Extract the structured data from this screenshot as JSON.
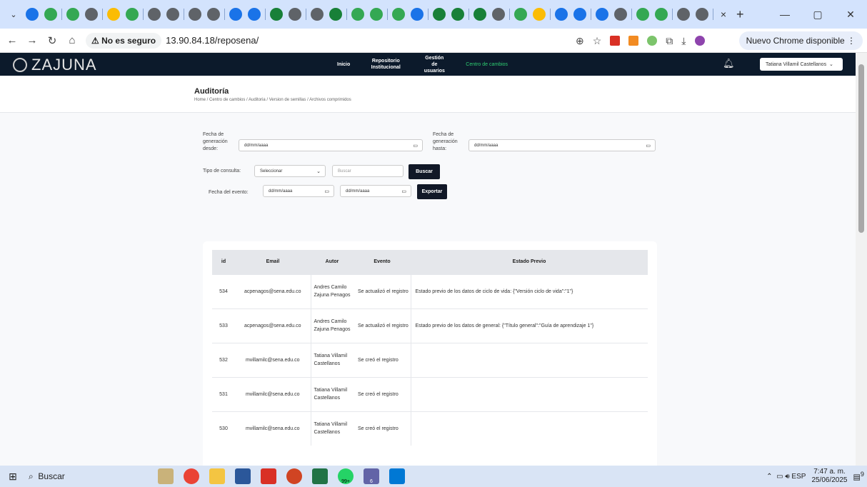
{
  "browser": {
    "tab_close": "×",
    "new_tab": "+",
    "insecure_label": "No es seguro",
    "url": "13.90.84.18/reposena/",
    "update_label": "Nuevo Chrome disponible"
  },
  "site": {
    "brand": "ZAJUNA",
    "menu": [
      "Inicio",
      "Repositorio Institucional",
      "Gestión de usuarios",
      "Centro de cambios"
    ],
    "user": "Tatiana Villamil Castellanos"
  },
  "header": {
    "title": "Auditoría",
    "breadcrumb": "Home / Centro de cambios / Auditoria / Version de semillas / Archivos comprimidos"
  },
  "filters": {
    "fecha_desde_label": "Fecha de generación desde:",
    "fecha_hasta_label": "Fecha de generación hasta:",
    "date_placeholder": "dd/mm/aaaa",
    "tipo_label": "Tipo de consulta:",
    "tipo_value": "Seleccionar",
    "search_placeholder": "Buscar",
    "buscar_button": "Buscar",
    "evento_label": "Fecha del evento:",
    "exportar_button": "Exportar"
  },
  "table": {
    "headers": [
      "id",
      "Email",
      "Autor",
      "Evento",
      "Estado Previo"
    ],
    "rows": [
      {
        "id": "534",
        "email": "acpenagos@sena.edu.co",
        "autor": "Andres Camilo Zajuna Penagos",
        "evento": "Se actualizó el registro",
        "estado": "Estado previo de los datos de ciclo de vida: {\"Versión ciclo de vida\":\"1\"}"
      },
      {
        "id": "533",
        "email": "acpenagos@sena.edu.co",
        "autor": "Andres Camilo Zajuna Penagos",
        "evento": "Se actualizó el registro",
        "estado": "Estado previo de los datos de general: {\"Título general\":\"Guía de aprendizaje 1\"}"
      },
      {
        "id": "532",
        "email": "mvillamilc@sena.edu.co",
        "autor": "Tatiana Villamil Castellanos",
        "evento": "Se creó el registro",
        "estado": ""
      },
      {
        "id": "531",
        "email": "mvillamilc@sena.edu.co",
        "autor": "Tatiana Villamil Castellanos",
        "evento": "Se creó el registro",
        "estado": ""
      },
      {
        "id": "530",
        "email": "mvillamilc@sena.edu.co",
        "autor": "Tatiana Villamil Castellanos",
        "evento": "Se creó el registro",
        "estado": ""
      }
    ]
  },
  "taskbar": {
    "search": "Buscar",
    "lang": "ESP",
    "time": "7:47 a. m.",
    "date": "25/06/2025",
    "badge_99": "99+",
    "badge_6": "6",
    "notif": "9"
  }
}
